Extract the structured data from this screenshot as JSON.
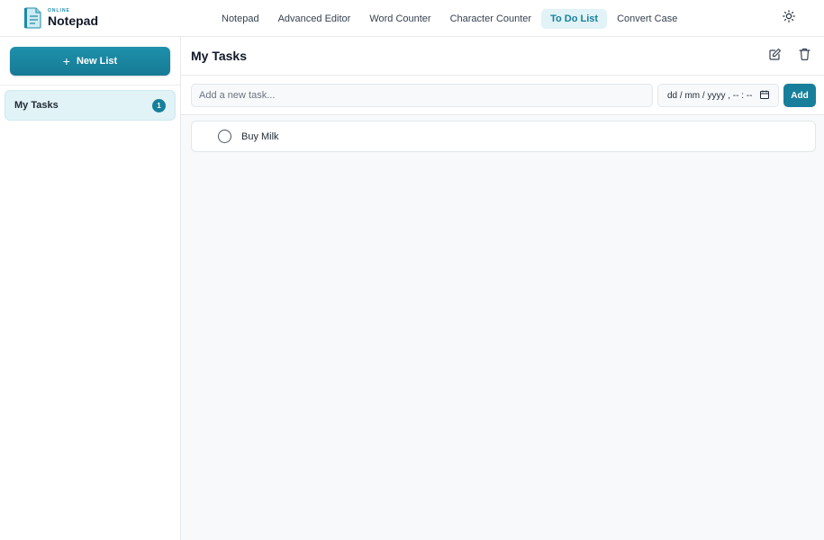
{
  "header": {
    "logo_small": "ONLINE",
    "logo_big": "Notepad",
    "nav": [
      {
        "label": "Notepad"
      },
      {
        "label": "Advanced Editor"
      },
      {
        "label": "Word Counter"
      },
      {
        "label": "Character Counter"
      },
      {
        "label": "To Do List",
        "active": true
      },
      {
        "label": "Convert Case"
      }
    ],
    "theme_icon": "sun-icon"
  },
  "sidebar": {
    "new_list_label": "New List",
    "lists": [
      {
        "label": "My Tasks",
        "count": "1"
      }
    ]
  },
  "main": {
    "title": "My Tasks",
    "add_task_placeholder": "Add a new task...",
    "date_placeholder": "dd / mm / yyyy ,  -- : --",
    "add_label": "Add",
    "tasks": [
      {
        "text": "Buy Milk"
      }
    ]
  },
  "colors": {
    "accent": "#177f9b",
    "active_bg": "#e1f3f7"
  }
}
